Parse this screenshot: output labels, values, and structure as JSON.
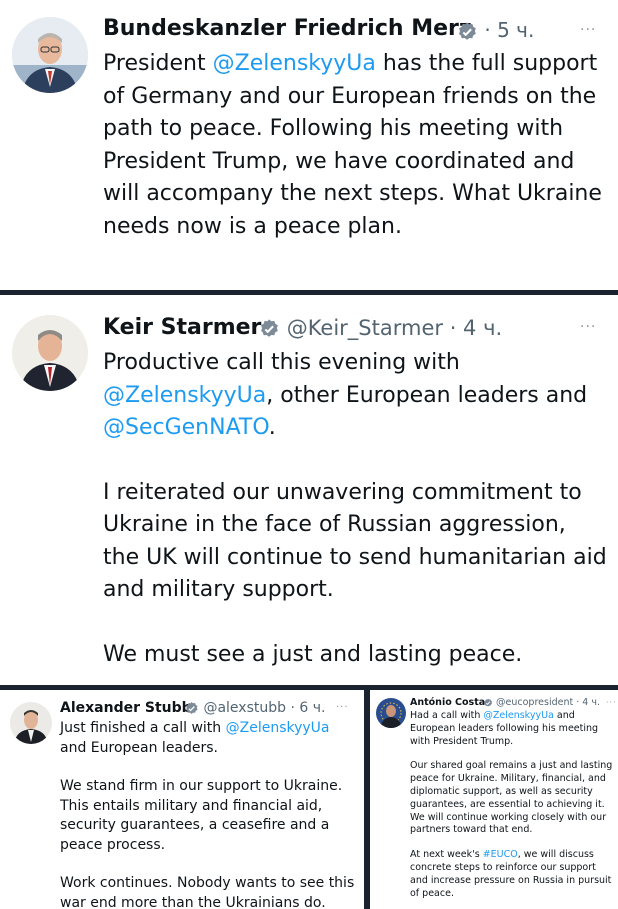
{
  "colors": {
    "link": "#1d9bf0",
    "text": "#0f1419",
    "meta": "#536471",
    "divider": "#1b2230"
  },
  "tweets": [
    {
      "name": "Bundeskanzler Friedrich Merz",
      "handle": "",
      "time": "· 5 ч.",
      "more": "···",
      "body": [
        [
          "President ",
          "@ZelenskyyUa",
          " has the full support of Germany and our European friends on the path to peace. Following his meeting with President Trump, we have coordinated and will accompany the next steps. What Ukraine needs now is a peace plan."
        ]
      ]
    },
    {
      "name": "Keir Starmer",
      "handle": "@Keir_Starmer",
      "time": "· 4 ч.",
      "more": "···",
      "body": [
        [
          "Productive call this evening with ",
          "@ZelenskyyUa",
          ", other European leaders and ",
          "@SecGenNATO",
          "."
        ],
        [
          "I reiterated our unwavering commitment to Ukraine in the face of Russian aggression, the UK will continue to send humanitarian aid and military support."
        ],
        [
          "We must see a just and lasting peace."
        ]
      ]
    },
    {
      "name": "Alexander Stubb",
      "handle": "@alexstubb",
      "time": "· 6 ч.",
      "more": "···",
      "body": [
        [
          "Just finished a call with ",
          "@ZelenskyyUa",
          " and European leaders."
        ],
        [
          "We stand firm in our support to Ukraine. This entails military and financial aid, security guarantees, a ceasefire and a peace process."
        ],
        [
          "Work continues. Nobody wants to see this war end more than the Ukrainians do."
        ]
      ]
    },
    {
      "name": "António Costa",
      "handle": "@eucopresident",
      "time": "· 4 ч.",
      "more": "···",
      "body": [
        [
          "Had a call with ",
          "@ZelenskyyUa",
          " and European leaders following his meeting with President Trump."
        ],
        [
          "Our shared goal remains a just and lasting peace for Ukraine. Military, financial, and diplomatic support, as well as security guarantees, are essential to achieving it. We will continue working closely with our partners toward that end."
        ],
        [
          "At next week's ",
          "#EUCO",
          ", we will discuss concrete steps to reinforce our support and increase pressure on Russia in pursuit of peace."
        ]
      ]
    }
  ]
}
